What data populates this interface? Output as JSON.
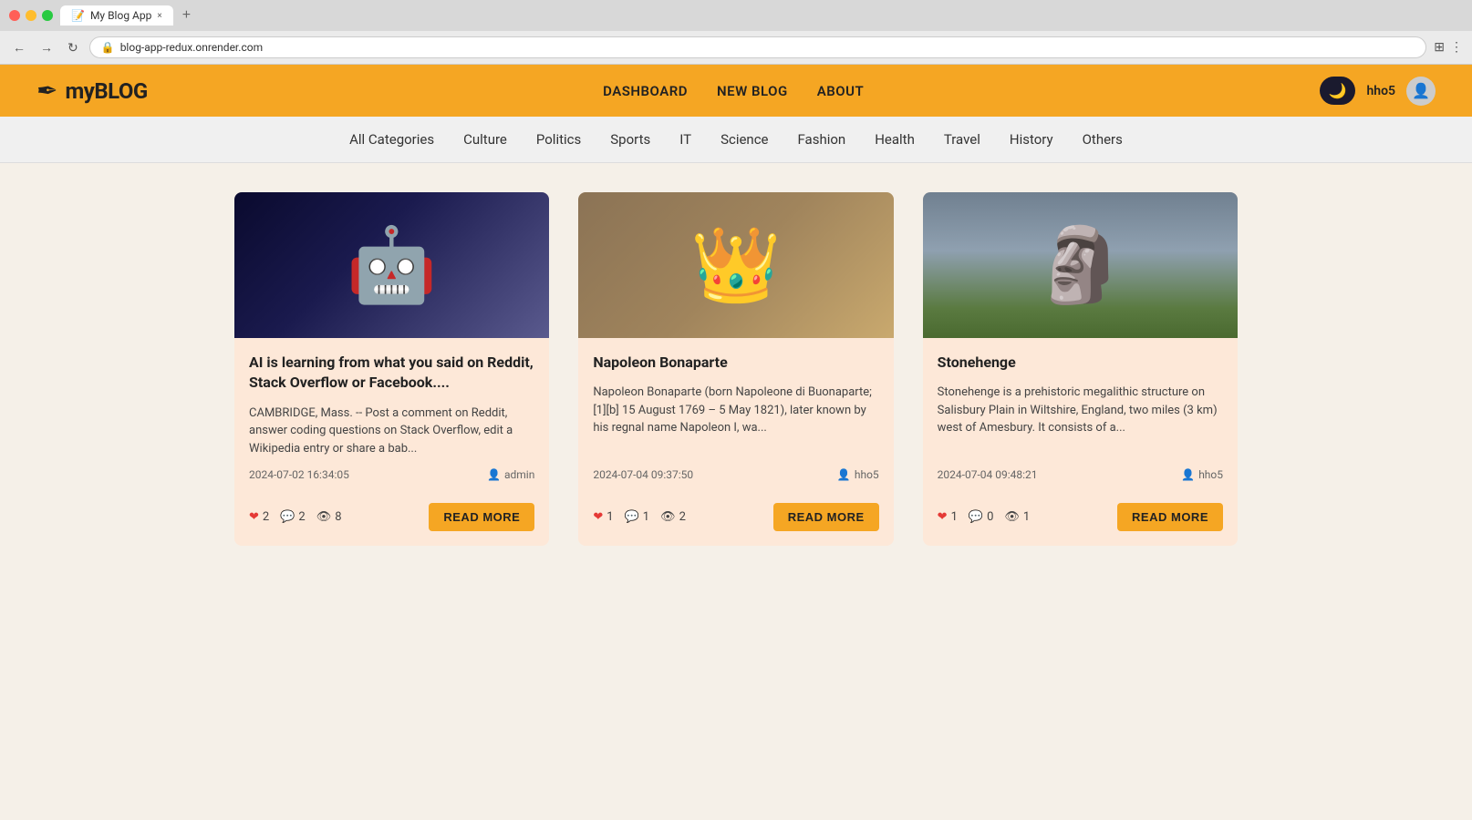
{
  "browser": {
    "tab_title": "My Blog App",
    "url": "blog-app-redux.onrender.com",
    "tab_close": "×",
    "tab_new": "+"
  },
  "header": {
    "logo_text": "myBLOG",
    "nav": {
      "dashboard": "DASHBOARD",
      "new_blog": "NEW BLOG",
      "about": "ABOUT"
    },
    "username": "hho5"
  },
  "categories": {
    "items": [
      {
        "label": "All Categories",
        "id": "all"
      },
      {
        "label": "Culture",
        "id": "culture"
      },
      {
        "label": "Politics",
        "id": "politics"
      },
      {
        "label": "Sports",
        "id": "sports"
      },
      {
        "label": "IT",
        "id": "it"
      },
      {
        "label": "Science",
        "id": "science"
      },
      {
        "label": "Fashion",
        "id": "fashion"
      },
      {
        "label": "Health",
        "id": "health"
      },
      {
        "label": "Travel",
        "id": "travel"
      },
      {
        "label": "History",
        "id": "history"
      },
      {
        "label": "Others",
        "id": "others"
      }
    ]
  },
  "cards": [
    {
      "id": "card-1",
      "title": "AI is learning from what you said on Reddit, Stack Overflow or Facebook....",
      "excerpt": "CAMBRIDGE, Mass. -- Post a comment on Reddit, answer coding questions on Stack Overflow, edit a Wikipedia entry or share a bab...",
      "date": "2024-07-02 16:34:05",
      "author": "admin",
      "likes": "2",
      "comments": "2",
      "views": "8",
      "image_type": "ai",
      "read_more": "READ MORE"
    },
    {
      "id": "card-2",
      "title": "Napoleon Bonaparte",
      "excerpt": "Napoleon Bonaparte (born Napoleone di Buonaparte;[1][b] 15 August 1769 – 5 May 1821), later known by his regnal name Napoleon I, wa...",
      "date": "2024-07-04 09:37:50",
      "author": "hho5",
      "likes": "1",
      "comments": "1",
      "views": "2",
      "image_type": "napoleon",
      "read_more": "READ MORE"
    },
    {
      "id": "card-3",
      "title": "Stonehenge",
      "excerpt": "Stonehenge is a prehistoric megalithic structure on Salisbury Plain in Wiltshire, England, two miles (3 km) west of Amesbury. It consists of a...",
      "date": "2024-07-04 09:48:21",
      "author": "hho5",
      "likes": "1",
      "comments": "0",
      "views": "1",
      "image_type": "stonehenge",
      "read_more": "READ MORE"
    }
  ]
}
